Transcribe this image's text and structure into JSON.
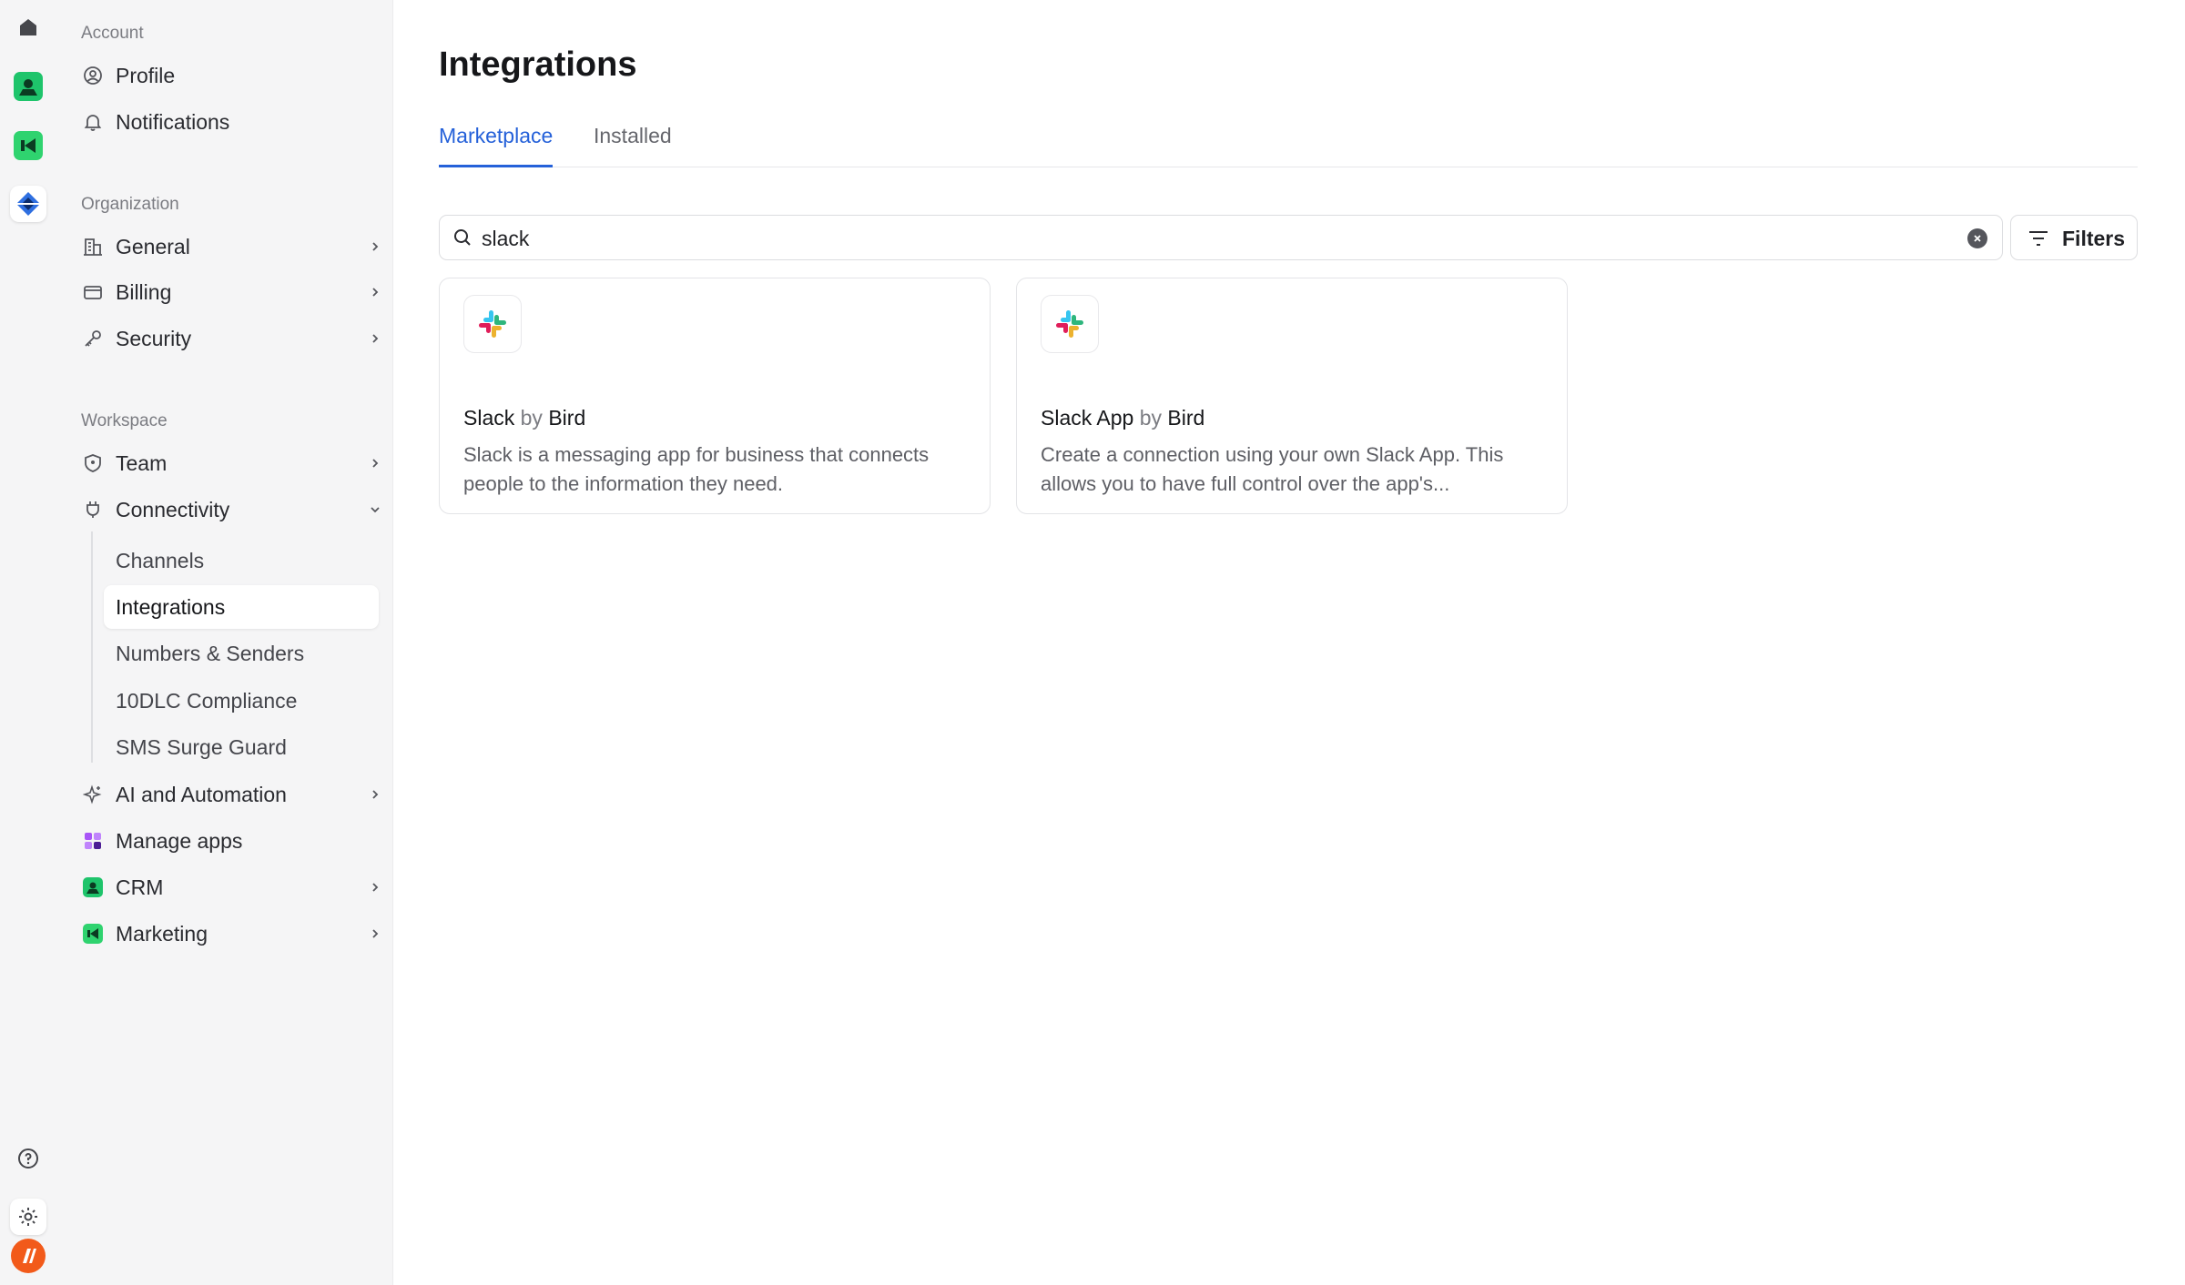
{
  "sidebar": {
    "sections": {
      "account": "Account",
      "organization": "Organization",
      "workspace": "Workspace"
    },
    "items": {
      "profile": "Profile",
      "notifications": "Notifications",
      "general": "General",
      "billing": "Billing",
      "security": "Security",
      "team": "Team",
      "connectivity": "Connectivity",
      "ai_automation": "AI and Automation",
      "manage_apps": "Manage apps",
      "crm": "CRM",
      "marketing": "Marketing"
    },
    "sub_items": {
      "channels": "Channels",
      "integrations": "Integrations",
      "numbers_senders": "Numbers & Senders",
      "compliance": "10DLC Compliance",
      "surge_guard": "SMS Surge Guard"
    }
  },
  "main": {
    "title": "Integrations",
    "tabs": [
      "Marketplace",
      "Installed"
    ],
    "active_tab": "Marketplace",
    "search": {
      "value": "slack"
    },
    "filters_label": "Filters",
    "cards": [
      {
        "name": "Slack",
        "by": "by",
        "vendor": "Bird",
        "description": "Slack is a messaging app for business that connects people to the information they need.",
        "icon": "slack-logo-icon"
      },
      {
        "name": "Slack App",
        "by": "by",
        "vendor": "Bird",
        "description": "Create a connection using your own Slack App. This allows you to have full control over the app's...",
        "icon": "slack-logo-icon"
      }
    ]
  },
  "colors": {
    "accent": "#2561d9",
    "rail_bg": "#f5f5f6",
    "brand_orange": "#f25a1a",
    "crm_green": "#1ec46b",
    "marketing_green": "#2fd36f",
    "product_blue": "#2f6fe0"
  }
}
